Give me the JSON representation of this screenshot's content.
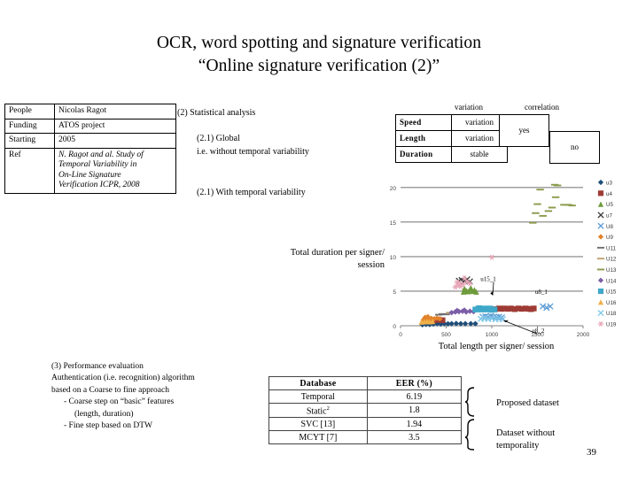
{
  "slide": {
    "title_line1": "OCR, word spotting and signature verification",
    "title_line2": "“Online signature verification (2)”",
    "page_number": "39"
  },
  "info_table": {
    "rows": [
      {
        "key": "People",
        "value": "Nicolas Ragot"
      },
      {
        "key": "Funding",
        "value": "ATOS project"
      },
      {
        "key": "Starting",
        "value": "2005"
      }
    ],
    "ref_key": "Ref",
    "ref_lines": [
      "N. Ragot and al. Study of",
      "Temporal Variability in",
      "On-Line Signature",
      "Verification  ICPR, 2008"
    ]
  },
  "steps": {
    "step2": "(2) Statistical analysis",
    "step21_line1": "(2.1) Global",
    "step21_line2": "i.e. without temporal variability",
    "step21b": "(2.1) With temporal variability"
  },
  "vc_table": {
    "head_variation": "variation",
    "head_correlation": "correlation",
    "rows": [
      {
        "label": "Speed",
        "value": "variation"
      },
      {
        "label": "Length",
        "value": "variation"
      },
      {
        "label": "Duration",
        "value": "stable"
      }
    ],
    "yes": "yes",
    "no": "no"
  },
  "performance": {
    "heading": "(3) Performance evaluation",
    "line2": "Authentication (i.e. recognition) algorithm",
    "line3": "based on a Coarse to fine approach",
    "bullet1": "- Coarse step on “basic” features",
    "bullet1b": "(length, duration)",
    "bullet2": "- Fine step based on DTW"
  },
  "results_table": {
    "headers": [
      "Database",
      "EER (%)"
    ],
    "rows": [
      {
        "database": "Temporal",
        "sup": "",
        "eer": "6.19"
      },
      {
        "database": "Static",
        "sup": "2",
        "eer": "1.8"
      },
      {
        "database": "SVC [13]",
        "sup": "",
        "eer": "1.94"
      },
      {
        "database": "MCYT [7]",
        "sup": "",
        "eer": "3.5"
      }
    ]
  },
  "annotations": {
    "brace_top_caption": "Proposed dataset",
    "brace_bottom_caption_l1": "Dataset without",
    "brace_bottom_caption_l2": "temporality"
  },
  "chart_data": {
    "type": "scatter",
    "title": "",
    "xlabel": "Total length per signer/ session",
    "ylabel": "Total duration per signer/ session",
    "xlim": [
      0,
      2000
    ],
    "ylim": [
      0,
      21
    ],
    "xticks": [
      0,
      500,
      1000,
      1500,
      2000
    ],
    "yticks": [
      0,
      5,
      10,
      15,
      20
    ],
    "grid": "horizontal",
    "legend_position": "right",
    "point_annotations": [
      {
        "text": "u15_1",
        "x": 1010,
        "y": 4.4
      },
      {
        "text": "u8_2",
        "x": 1130,
        "y": 0.75
      },
      {
        "text": "u8_1",
        "x": 1620,
        "y": 3.3
      }
    ],
    "series": [
      {
        "name": "u3",
        "color": "#1f4e79",
        "marker": "diamond",
        "points": [
          [
            240,
            0.15
          ],
          [
            280,
            0.2
          ],
          [
            320,
            0.18
          ],
          [
            360,
            0.25
          ],
          [
            400,
            0.3
          ],
          [
            440,
            0.25
          ],
          [
            480,
            0.3
          ],
          [
            520,
            0.28
          ],
          [
            560,
            0.3
          ],
          [
            610,
            0.32
          ],
          [
            660,
            0.3
          ],
          [
            710,
            0.3
          ],
          [
            770,
            0.3
          ],
          [
            820,
            0.3
          ]
        ]
      },
      {
        "name": "u4",
        "color": "#9e3b34",
        "marker": "square",
        "points": [
          [
            1040,
            2.4
          ],
          [
            1080,
            2.5
          ],
          [
            1110,
            2.45
          ],
          [
            1140,
            2.5
          ],
          [
            1180,
            2.45
          ],
          [
            1210,
            2.5
          ],
          [
            1250,
            2.4
          ],
          [
            1290,
            2.5
          ],
          [
            1330,
            2.45
          ],
          [
            1370,
            2.5
          ],
          [
            1400,
            2.45
          ],
          [
            1430,
            2.4
          ],
          [
            1460,
            2.5
          ],
          [
            340,
            0.75
          ],
          [
            380,
            0.8
          ],
          [
            420,
            0.85
          ],
          [
            460,
            0.8
          ]
        ]
      },
      {
        "name": "U5",
        "color": "#6e9b3c",
        "marker": "triangle",
        "points": [
          [
            690,
            4.9
          ],
          [
            720,
            5.1
          ],
          [
            740,
            4.95
          ],
          [
            760,
            5.2
          ],
          [
            790,
            5.0
          ],
          [
            810,
            5.2
          ],
          [
            830,
            4.9
          ],
          [
            700,
            5.4
          ],
          [
            770,
            5.5
          ]
        ]
      },
      {
        "name": "u7",
        "color": "#3a3a3a",
        "marker": "x",
        "points": [
          [
            640,
            6.5
          ],
          [
            670,
            6.6
          ],
          [
            700,
            6.5
          ],
          [
            730,
            6.7
          ],
          [
            760,
            6.4
          ]
        ]
      },
      {
        "name": "U8",
        "color": "#5b9bd5",
        "marker": "cross",
        "points": [
          [
            900,
            1.3
          ],
          [
            930,
            1.35
          ],
          [
            960,
            1.3
          ],
          [
            990,
            1.4
          ],
          [
            1020,
            1.3
          ],
          [
            1050,
            1.25
          ],
          [
            1080,
            1.3
          ],
          [
            1110,
            1.2
          ],
          [
            1560,
            2.8
          ],
          [
            1600,
            2.6
          ],
          [
            1640,
            2.8
          ]
        ]
      },
      {
        "name": "U9",
        "color": "#e2822a",
        "marker": "diamond",
        "points": [
          [
            250,
            0.85
          ],
          [
            280,
            0.95
          ],
          [
            310,
            1.0
          ],
          [
            340,
            1.05
          ],
          [
            370,
            1.0
          ],
          [
            400,
            1.1
          ],
          [
            430,
            1.0
          ],
          [
            270,
            1.2
          ],
          [
            300,
            1.3
          ]
        ]
      },
      {
        "name": "U11",
        "color": "#6f6f6f",
        "marker": "dash",
        "points": [
          [
            420,
            1.6
          ],
          [
            460,
            1.7
          ],
          [
            500,
            1.65
          ]
        ]
      },
      {
        "name": "U12",
        "color": "#c0a16b",
        "marker": "dash",
        "points": [
          [
            540,
            1.9
          ],
          [
            580,
            1.95
          ]
        ]
      },
      {
        "name": "U13",
        "color": "#8a9a4a",
        "marker": "dash",
        "points": [
          [
            1450,
            14.9
          ],
          [
            1480,
            16.3
          ],
          [
            1500,
            17.6
          ],
          [
            1530,
            19.7
          ],
          [
            1560,
            15.9
          ],
          [
            1620,
            16.6
          ],
          [
            1660,
            17.1
          ],
          [
            1690,
            20.4
          ],
          [
            1700,
            18.6
          ],
          [
            1720,
            20.3
          ],
          [
            1790,
            17.5
          ],
          [
            1840,
            17.5
          ],
          [
            1880,
            17.4
          ]
        ]
      },
      {
        "name": "U14",
        "color": "#7b5ea7",
        "marker": "diamond",
        "points": [
          [
            560,
            1.9
          ],
          [
            600,
            2.0
          ],
          [
            640,
            2.05
          ],
          [
            680,
            2.1
          ],
          [
            720,
            2.0
          ],
          [
            760,
            2.1
          ],
          [
            800,
            2.05
          ],
          [
            620,
            2.2
          ],
          [
            700,
            2.25
          ]
        ]
      },
      {
        "name": "U15",
        "color": "#3fa8c9",
        "marker": "square",
        "points": [
          [
            820,
            2.35
          ],
          [
            850,
            2.4
          ],
          [
            880,
            2.35
          ],
          [
            910,
            2.4
          ],
          [
            940,
            2.35
          ],
          [
            970,
            2.4
          ],
          [
            1000,
            2.3
          ],
          [
            1030,
            2.35
          ],
          [
            860,
            2.55
          ],
          [
            920,
            2.5
          ],
          [
            980,
            2.5
          ]
        ]
      },
      {
        "name": "U16",
        "color": "#f0b049",
        "marker": "triangle",
        "points": [
          [
            230,
            0.55
          ],
          [
            260,
            0.6
          ],
          [
            290,
            0.65
          ],
          [
            320,
            0.6
          ],
          [
            350,
            0.65
          ]
        ]
      },
      {
        "name": "U18",
        "color": "#7fc8e8",
        "marker": "x",
        "points": [
          [
            880,
            1.0
          ],
          [
            920,
            1.05
          ],
          [
            960,
            1.0
          ],
          [
            1000,
            1.05
          ],
          [
            1040,
            0.95
          ],
          [
            1080,
            1.0
          ],
          [
            1120,
            0.95
          ]
        ]
      },
      {
        "name": "U19",
        "color": "#e9a7b8",
        "marker": "star",
        "points": [
          [
            600,
            5.6
          ],
          [
            630,
            5.8
          ],
          [
            660,
            5.7
          ],
          [
            690,
            6.0
          ],
          [
            620,
            6.3
          ],
          [
            650,
            6.2
          ],
          [
            1000,
            9.9
          ],
          [
            700,
            6.9
          ],
          [
            730,
            6.4
          ],
          [
            760,
            6.1
          ]
        ]
      }
    ]
  }
}
